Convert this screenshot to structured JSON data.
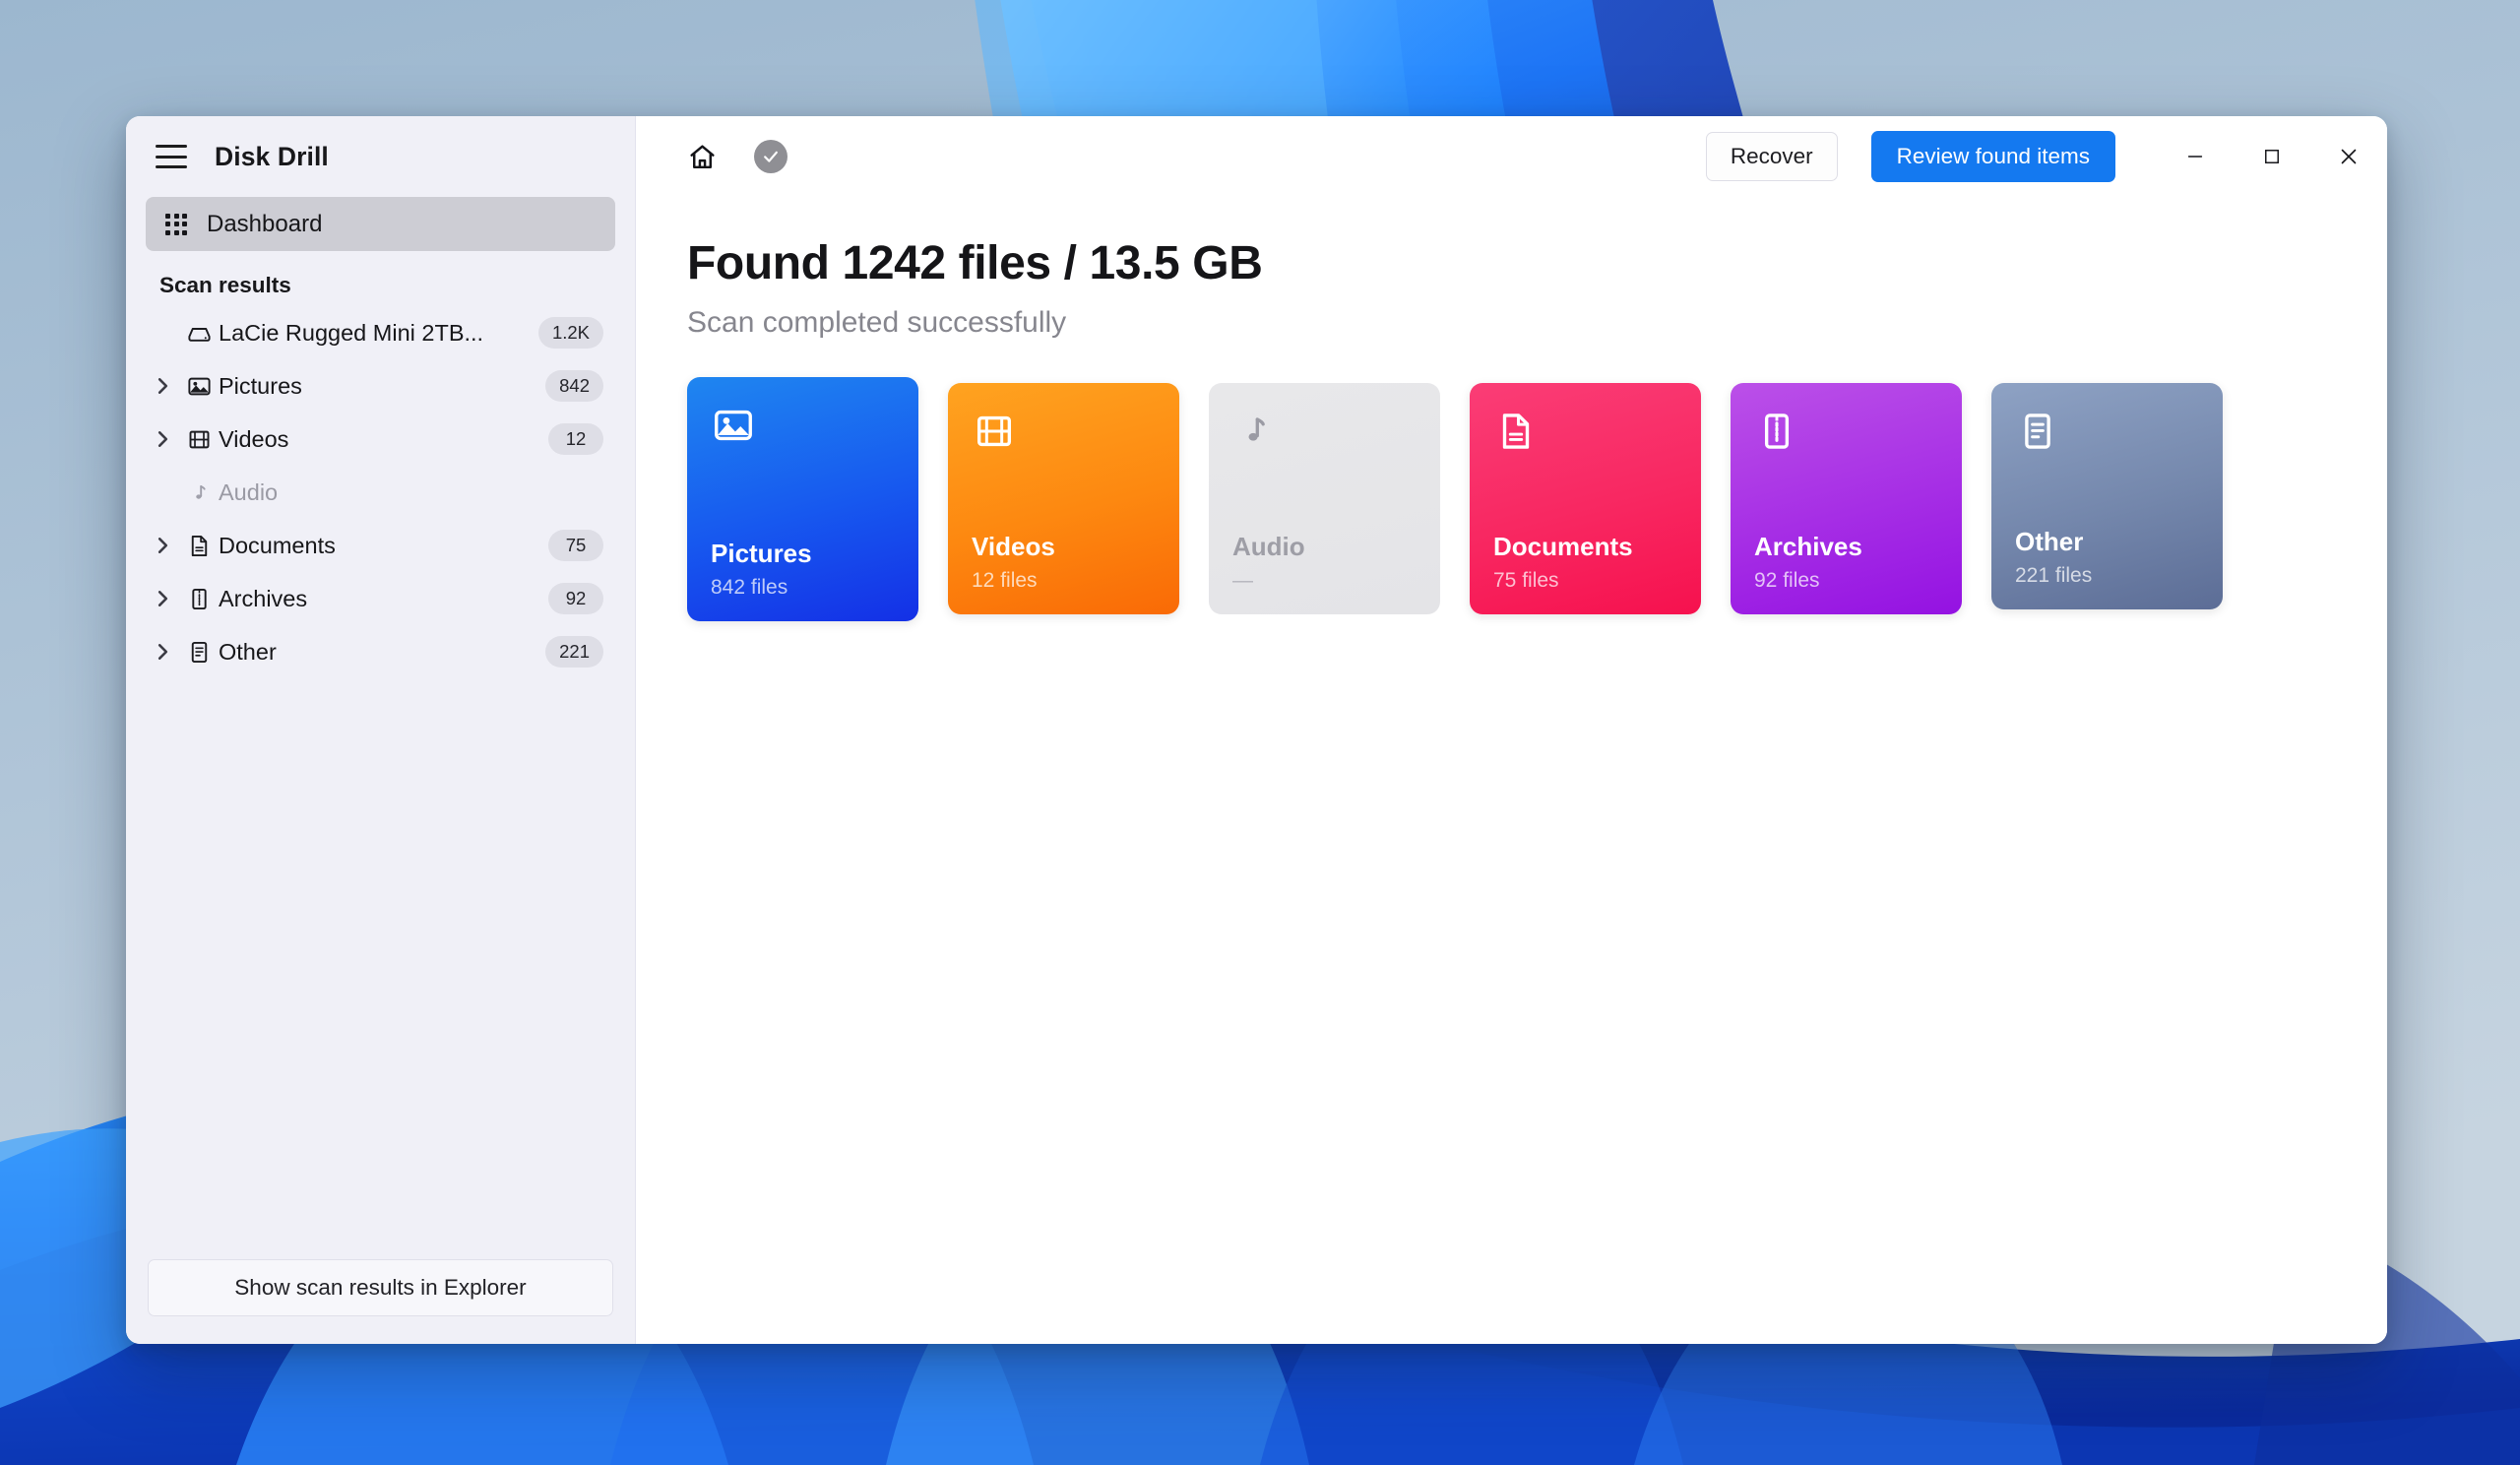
{
  "window": {
    "app_title": "Disk Drill",
    "menu_icon": "hamburger-icon"
  },
  "sidebar": {
    "nav": [
      {
        "label": "Dashboard",
        "icon": "grid-icon",
        "active": true
      }
    ],
    "section_title": "Scan results",
    "tree": [
      {
        "label": "LaCie Rugged Mini 2TB...",
        "badge": "1.2K",
        "icon": "hard-drive-icon",
        "expandable": false,
        "muted": false
      },
      {
        "label": "Pictures",
        "badge": "842",
        "icon": "image-icon",
        "expandable": true,
        "muted": false
      },
      {
        "label": "Videos",
        "badge": "12",
        "icon": "film-icon",
        "expandable": true,
        "muted": false
      },
      {
        "label": "Audio",
        "badge": "",
        "icon": "music-note-icon",
        "expandable": false,
        "muted": true
      },
      {
        "label": "Documents",
        "badge": "75",
        "icon": "document-icon",
        "expandable": true,
        "muted": false
      },
      {
        "label": "Archives",
        "badge": "92",
        "icon": "archive-zip-icon",
        "expandable": true,
        "muted": false
      },
      {
        "label": "Other",
        "badge": "221",
        "icon": "file-lines-icon",
        "expandable": true,
        "muted": false
      }
    ],
    "footer_button": "Show scan results in Explorer"
  },
  "toolbar": {
    "home_icon": "home-icon",
    "status_icon": "check-circle-icon",
    "recover_label": "Recover",
    "review_label": "Review found items",
    "minimize_label": "—",
    "maximize_label": "☐",
    "close_label": "✕",
    "accent_color": "#1479f0"
  },
  "main": {
    "headline": "Found 1242 files / 13.5 GB",
    "subhead": "Scan completed successfully",
    "cards": [
      {
        "name": "Pictures",
        "count": "842 files",
        "icon": "image-icon",
        "color_start": "#1f86f0",
        "color_end": "#1430e6",
        "disabled": false,
        "size": "tall"
      },
      {
        "name": "Videos",
        "count": "12 files",
        "icon": "film-icon",
        "color_start": "#ffa320",
        "color_end": "#f96a06",
        "disabled": false,
        "size": "normal"
      },
      {
        "name": "Audio",
        "count": "—",
        "icon": "music-note-icon",
        "color_start": "#e6e6e8",
        "color_end": "#e3e3e6",
        "disabled": true,
        "size": "normal"
      },
      {
        "name": "Documents",
        "count": "75 files",
        "icon": "document-icon",
        "color_start": "#fa3d76",
        "color_end": "#f6114e",
        "disabled": false,
        "size": "normal"
      },
      {
        "name": "Archives",
        "count": "92 files",
        "icon": "archive-zip-icon",
        "color_start": "#bb50e8",
        "color_end": "#9412e2",
        "disabled": false,
        "size": "normal"
      },
      {
        "name": "Other",
        "count": "221 files",
        "icon": "file-lines-icon",
        "color_start": "#8ea2c4",
        "color_end": "#5c6d96",
        "disabled": false,
        "size": "short"
      }
    ]
  }
}
